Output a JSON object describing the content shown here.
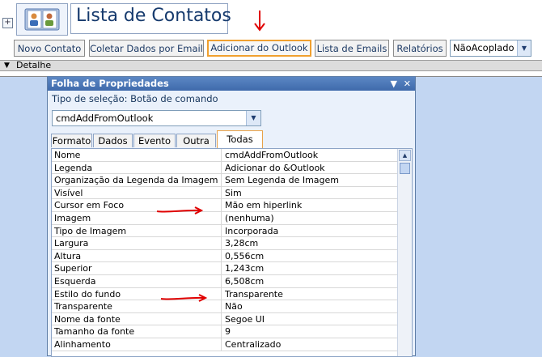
{
  "form": {
    "title": "Lista de Contatos",
    "buttons": [
      {
        "label": "Novo Contato"
      },
      {
        "label": "Coletar Dados por Email"
      },
      {
        "label": "Adicionar do Outlook"
      },
      {
        "label": "Lista de Emails"
      },
      {
        "label": "Relatórios"
      }
    ],
    "dock_combo_value": "NãoAcoplado",
    "section_label": "Detalhe"
  },
  "property_sheet": {
    "title": "Folha de Propriedades",
    "selection_type": "Tipo de seleção:  Botão de comando",
    "object_combo_value": "cmdAddFromOutlook",
    "tabs": [
      "Formato",
      "Dados",
      "Evento",
      "Outra",
      "Todas"
    ],
    "active_tab": "Todas",
    "rows": [
      {
        "name": "Nome",
        "value": "cmdAddFromOutlook"
      },
      {
        "name": "Legenda",
        "value": "Adicionar do &Outlook"
      },
      {
        "name": "Organização da Legenda da Imagem",
        "value": "Sem Legenda de Imagem"
      },
      {
        "name": "Visível",
        "value": "Sim"
      },
      {
        "name": "Cursor em Foco",
        "value": "Mão em hiperlink"
      },
      {
        "name": "Imagem",
        "value": "(nenhuma)"
      },
      {
        "name": "Tipo de Imagem",
        "value": "Incorporada"
      },
      {
        "name": "Largura",
        "value": "3,28cm"
      },
      {
        "name": "Altura",
        "value": "0,556cm"
      },
      {
        "name": "Superior",
        "value": "1,243cm"
      },
      {
        "name": "Esquerda",
        "value": "6,508cm"
      },
      {
        "name": "Estilo do fundo",
        "value": "Transparente"
      },
      {
        "name": "Transparente",
        "value": "Não"
      },
      {
        "name": "Nome da fonte",
        "value": "Segoe UI"
      },
      {
        "name": "Tamanho da fonte",
        "value": "9"
      },
      {
        "name": "Alinhamento",
        "value": "Centralizado"
      }
    ]
  },
  "colors": {
    "highlight_border": "#f0a030",
    "annotation_red": "#e00000",
    "titlebar": "#4a77b8"
  }
}
